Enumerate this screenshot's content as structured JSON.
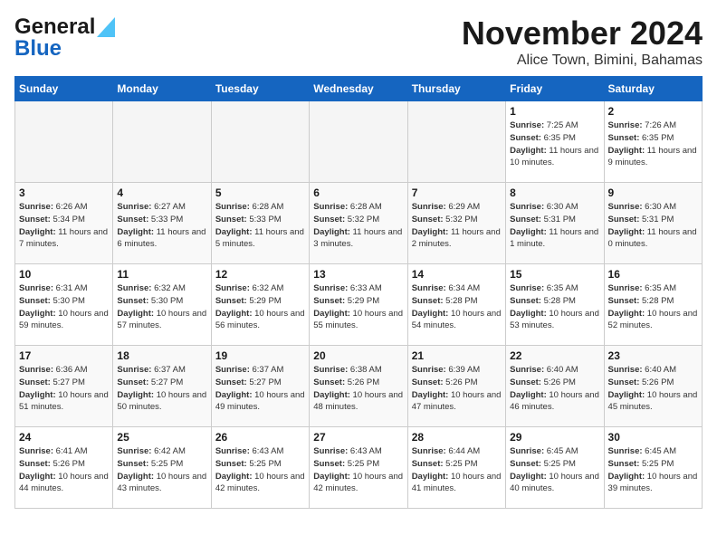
{
  "header": {
    "logo_line1": "General",
    "logo_line2": "Blue",
    "month": "November 2024",
    "location": "Alice Town, Bimini, Bahamas"
  },
  "weekdays": [
    "Sunday",
    "Monday",
    "Tuesday",
    "Wednesday",
    "Thursday",
    "Friday",
    "Saturday"
  ],
  "weeks": [
    [
      {
        "day": "",
        "info": ""
      },
      {
        "day": "",
        "info": ""
      },
      {
        "day": "",
        "info": ""
      },
      {
        "day": "",
        "info": ""
      },
      {
        "day": "",
        "info": ""
      },
      {
        "day": "1",
        "info": "Sunrise: 7:25 AM\nSunset: 6:35 PM\nDaylight: 11 hours and 10 minutes."
      },
      {
        "day": "2",
        "info": "Sunrise: 7:26 AM\nSunset: 6:35 PM\nDaylight: 11 hours and 9 minutes."
      }
    ],
    [
      {
        "day": "3",
        "info": "Sunrise: 6:26 AM\nSunset: 5:34 PM\nDaylight: 11 hours and 7 minutes."
      },
      {
        "day": "4",
        "info": "Sunrise: 6:27 AM\nSunset: 5:33 PM\nDaylight: 11 hours and 6 minutes."
      },
      {
        "day": "5",
        "info": "Sunrise: 6:28 AM\nSunset: 5:33 PM\nDaylight: 11 hours and 5 minutes."
      },
      {
        "day": "6",
        "info": "Sunrise: 6:28 AM\nSunset: 5:32 PM\nDaylight: 11 hours and 3 minutes."
      },
      {
        "day": "7",
        "info": "Sunrise: 6:29 AM\nSunset: 5:32 PM\nDaylight: 11 hours and 2 minutes."
      },
      {
        "day": "8",
        "info": "Sunrise: 6:30 AM\nSunset: 5:31 PM\nDaylight: 11 hours and 1 minute."
      },
      {
        "day": "9",
        "info": "Sunrise: 6:30 AM\nSunset: 5:31 PM\nDaylight: 11 hours and 0 minutes."
      }
    ],
    [
      {
        "day": "10",
        "info": "Sunrise: 6:31 AM\nSunset: 5:30 PM\nDaylight: 10 hours and 59 minutes."
      },
      {
        "day": "11",
        "info": "Sunrise: 6:32 AM\nSunset: 5:30 PM\nDaylight: 10 hours and 57 minutes."
      },
      {
        "day": "12",
        "info": "Sunrise: 6:32 AM\nSunset: 5:29 PM\nDaylight: 10 hours and 56 minutes."
      },
      {
        "day": "13",
        "info": "Sunrise: 6:33 AM\nSunset: 5:29 PM\nDaylight: 10 hours and 55 minutes."
      },
      {
        "day": "14",
        "info": "Sunrise: 6:34 AM\nSunset: 5:28 PM\nDaylight: 10 hours and 54 minutes."
      },
      {
        "day": "15",
        "info": "Sunrise: 6:35 AM\nSunset: 5:28 PM\nDaylight: 10 hours and 53 minutes."
      },
      {
        "day": "16",
        "info": "Sunrise: 6:35 AM\nSunset: 5:28 PM\nDaylight: 10 hours and 52 minutes."
      }
    ],
    [
      {
        "day": "17",
        "info": "Sunrise: 6:36 AM\nSunset: 5:27 PM\nDaylight: 10 hours and 51 minutes."
      },
      {
        "day": "18",
        "info": "Sunrise: 6:37 AM\nSunset: 5:27 PM\nDaylight: 10 hours and 50 minutes."
      },
      {
        "day": "19",
        "info": "Sunrise: 6:37 AM\nSunset: 5:27 PM\nDaylight: 10 hours and 49 minutes."
      },
      {
        "day": "20",
        "info": "Sunrise: 6:38 AM\nSunset: 5:26 PM\nDaylight: 10 hours and 48 minutes."
      },
      {
        "day": "21",
        "info": "Sunrise: 6:39 AM\nSunset: 5:26 PM\nDaylight: 10 hours and 47 minutes."
      },
      {
        "day": "22",
        "info": "Sunrise: 6:40 AM\nSunset: 5:26 PM\nDaylight: 10 hours and 46 minutes."
      },
      {
        "day": "23",
        "info": "Sunrise: 6:40 AM\nSunset: 5:26 PM\nDaylight: 10 hours and 45 minutes."
      }
    ],
    [
      {
        "day": "24",
        "info": "Sunrise: 6:41 AM\nSunset: 5:26 PM\nDaylight: 10 hours and 44 minutes."
      },
      {
        "day": "25",
        "info": "Sunrise: 6:42 AM\nSunset: 5:25 PM\nDaylight: 10 hours and 43 minutes."
      },
      {
        "day": "26",
        "info": "Sunrise: 6:43 AM\nSunset: 5:25 PM\nDaylight: 10 hours and 42 minutes."
      },
      {
        "day": "27",
        "info": "Sunrise: 6:43 AM\nSunset: 5:25 PM\nDaylight: 10 hours and 42 minutes."
      },
      {
        "day": "28",
        "info": "Sunrise: 6:44 AM\nSunset: 5:25 PM\nDaylight: 10 hours and 41 minutes."
      },
      {
        "day": "29",
        "info": "Sunrise: 6:45 AM\nSunset: 5:25 PM\nDaylight: 10 hours and 40 minutes."
      },
      {
        "day": "30",
        "info": "Sunrise: 6:45 AM\nSunset: 5:25 PM\nDaylight: 10 hours and 39 minutes."
      }
    ]
  ]
}
